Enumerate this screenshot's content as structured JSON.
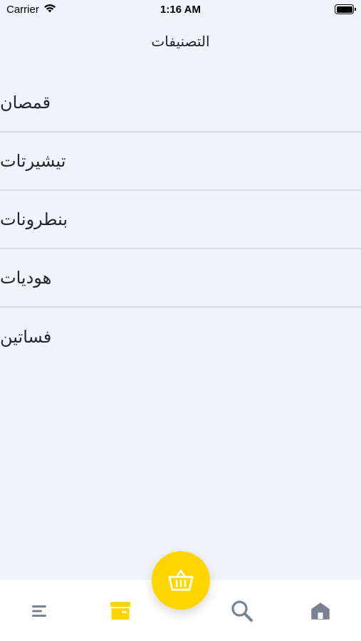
{
  "status_bar": {
    "carrier": "Carrier",
    "time": "1:16 AM",
    "wifi_icon": "wifi-icon",
    "battery_icon": "battery-icon"
  },
  "header": {
    "title": "التصنيفات"
  },
  "categories": [
    {
      "label": "قمصان"
    },
    {
      "label": "تيشيرتات"
    },
    {
      "label": "بنطرونات"
    },
    {
      "label": "هوديات"
    },
    {
      "label": "فساتين"
    }
  ],
  "tab_bar": {
    "items": [
      {
        "icon": "menu-icon",
        "active": false
      },
      {
        "icon": "archive-box-icon",
        "active": true
      },
      {
        "icon": "search-icon",
        "active": false
      },
      {
        "icon": "home-icon",
        "active": false
      }
    ],
    "fab_icon": "basket-icon"
  },
  "colors": {
    "background": "#f0f3f8",
    "accent": "#ffd500",
    "icon_inactive": "#7a8193",
    "divider": "#d7dbe2"
  }
}
